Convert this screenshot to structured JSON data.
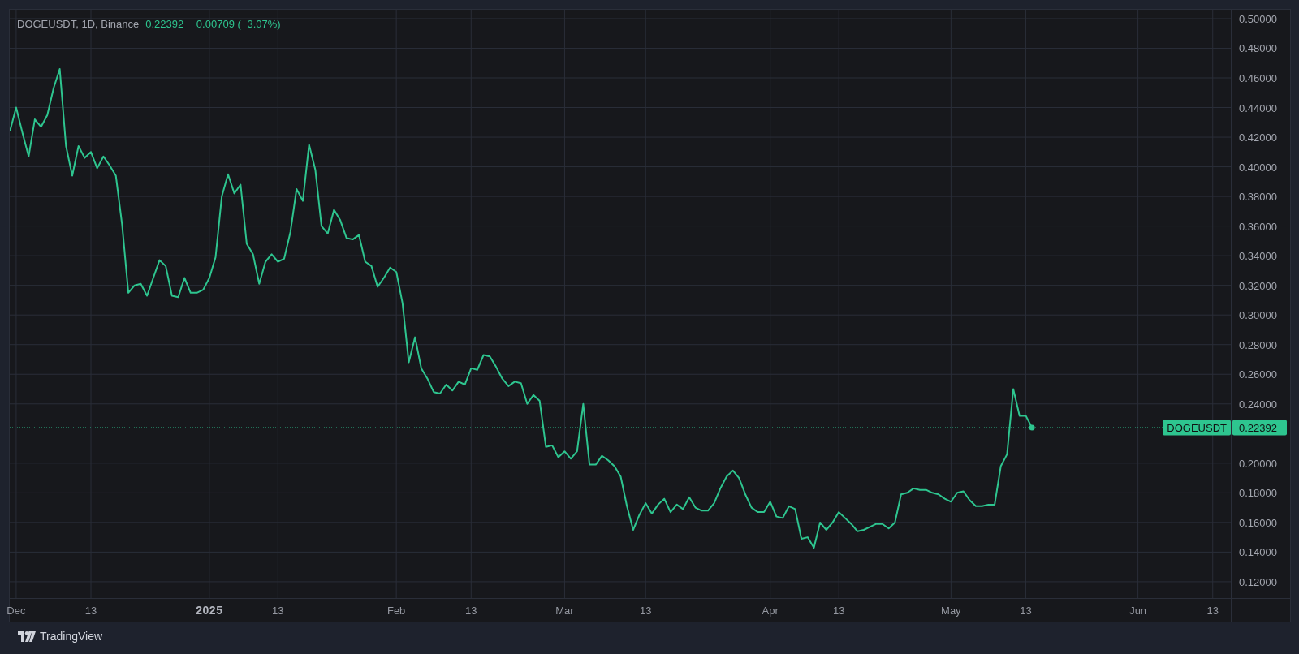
{
  "legend": {
    "symbol": "DOGEUSDT, 1D, Binance",
    "price": "0.22392",
    "change": "−0.00709 (−3.07%)"
  },
  "chart_data": {
    "type": "line",
    "grid": true,
    "ylim": [
      0.109,
      0.506
    ],
    "categories": [
      null,
      "Dec",
      null,
      null,
      null,
      null,
      null,
      null,
      null,
      null,
      null,
      null,
      null,
      "13",
      null,
      null,
      null,
      null,
      null,
      null,
      null,
      null,
      null,
      null,
      null,
      null,
      null,
      null,
      null,
      null,
      null,
      null,
      "2025",
      null,
      null,
      null,
      null,
      null,
      null,
      null,
      null,
      null,
      null,
      "13",
      null,
      null,
      null,
      null,
      null,
      null,
      null,
      null,
      null,
      null,
      null,
      null,
      null,
      null,
      null,
      null,
      null,
      null,
      "Feb",
      null,
      null,
      null,
      null,
      null,
      null,
      null,
      null,
      null,
      null,
      null,
      "13",
      null,
      null,
      null,
      null,
      null,
      null,
      null,
      null,
      null,
      null,
      null,
      null,
      null,
      null,
      "Mar",
      null,
      null,
      null,
      null,
      null,
      null,
      null,
      null,
      null,
      null,
      null,
      null,
      "13",
      null,
      null,
      null,
      null,
      null,
      null,
      null,
      null,
      null,
      null,
      null,
      null,
      null,
      null,
      null,
      null,
      null,
      null,
      null,
      "Apr",
      null,
      null,
      null,
      null,
      null,
      null,
      null,
      null,
      null,
      null,
      "13",
      null,
      null,
      null,
      null,
      null,
      null,
      null,
      null,
      null,
      null,
      null,
      null,
      null,
      null,
      null,
      null,
      null,
      "May",
      null,
      null,
      null,
      null,
      null,
      null,
      null,
      null,
      null,
      null,
      null,
      "13",
      null,
      null,
      null,
      null,
      null,
      null,
      null,
      null,
      null,
      null,
      null,
      null,
      null,
      null,
      null,
      null,
      null,
      "Jun",
      null,
      null,
      null,
      null,
      null,
      null,
      null,
      null,
      null,
      null,
      null,
      "13",
      null,
      null,
      null
    ],
    "yticks": [
      {
        "value": 0.5,
        "label": "0.50000"
      },
      {
        "value": 0.48,
        "label": "0.48000"
      },
      {
        "value": 0.46,
        "label": "0.46000"
      },
      {
        "value": 0.44,
        "label": "0.44000"
      },
      {
        "value": 0.42,
        "label": "0.42000"
      },
      {
        "value": 0.4,
        "label": "0.40000"
      },
      {
        "value": 0.38,
        "label": "0.38000"
      },
      {
        "value": 0.36,
        "label": "0.36000"
      },
      {
        "value": 0.34,
        "label": "0.34000"
      },
      {
        "value": 0.32,
        "label": "0.32000"
      },
      {
        "value": 0.3,
        "label": "0.30000"
      },
      {
        "value": 0.28,
        "label": "0.28000"
      },
      {
        "value": 0.26,
        "label": "0.26000"
      },
      {
        "value": 0.24,
        "label": "0.24000"
      },
      {
        "value": 0.2,
        "label": "0.20000"
      },
      {
        "value": 0.18,
        "label": "0.18000"
      },
      {
        "value": 0.16,
        "label": "0.16000"
      },
      {
        "value": 0.14,
        "label": "0.14000"
      },
      {
        "value": 0.12,
        "label": "0.12000"
      }
    ],
    "series": [
      {
        "name": "DOGEUSDT",
        "color": "#2ec58f",
        "values": [
          0.424,
          0.44,
          0.423,
          0.407,
          0.432,
          0.427,
          0.435,
          0.453,
          0.466,
          0.414,
          0.394,
          0.414,
          0.406,
          0.41,
          0.399,
          0.407,
          0.401,
          0.394,
          0.361,
          0.315,
          0.32,
          0.321,
          0.313,
          0.325,
          0.337,
          0.333,
          0.313,
          0.312,
          0.325,
          0.315,
          0.315,
          0.317,
          0.325,
          0.339,
          0.38,
          0.395,
          0.382,
          0.388,
          0.348,
          0.341,
          0.321,
          0.336,
          0.341,
          0.336,
          0.338,
          0.356,
          0.385,
          0.377,
          0.415,
          0.398,
          0.36,
          0.355,
          0.371,
          0.364,
          0.352,
          0.351,
          0.354,
          0.336,
          0.333,
          0.319,
          0.325,
          0.332,
          0.329,
          0.308,
          0.268,
          0.285,
          0.264,
          0.257,
          0.248,
          0.247,
          0.253,
          0.249,
          0.255,
          0.253,
          0.264,
          0.263,
          0.273,
          0.272,
          0.265,
          0.257,
          0.252,
          0.255,
          0.254,
          0.24,
          0.246,
          0.242,
          0.211,
          0.212,
          0.204,
          0.208,
          0.203,
          0.208,
          0.24,
          0.199,
          0.199,
          0.205,
          0.202,
          0.198,
          0.191,
          0.171,
          0.155,
          0.165,
          0.173,
          0.166,
          0.172,
          0.176,
          0.167,
          0.172,
          0.169,
          0.177,
          0.17,
          0.168,
          0.168,
          0.173,
          0.183,
          0.191,
          0.195,
          0.19,
          0.179,
          0.17,
          0.167,
          0.167,
          0.174,
          0.164,
          0.163,
          0.171,
          0.169,
          0.149,
          0.15,
          0.143,
          0.16,
          0.155,
          0.16,
          0.167,
          0.163,
          0.159,
          0.154,
          0.155,
          0.157,
          0.159,
          0.159,
          0.156,
          0.16,
          0.179,
          0.18,
          0.183,
          0.182,
          0.182,
          0.18,
          0.179,
          0.176,
          0.174,
          0.18,
          0.181,
          0.175,
          0.171,
          0.171,
          0.172,
          0.172,
          0.198,
          0.206,
          0.25,
          0.232,
          0.232,
          0.224,
          null,
          null,
          null,
          null,
          null,
          null,
          null,
          null,
          null,
          null,
          null,
          null,
          null,
          null,
          null,
          null,
          null,
          null,
          null,
          null,
          null,
          null,
          null,
          null,
          null,
          null,
          null,
          null,
          null,
          null,
          null,
          null
        ]
      }
    ]
  },
  "time_axis": {
    "labels_emphasized": [
      false,
      false,
      true,
      false,
      false,
      false,
      false,
      false,
      false,
      false,
      false,
      false,
      false,
      false
    ]
  },
  "last_price": {
    "price_label": "0.22392"
  },
  "footer": {
    "brand": "TradingView"
  }
}
